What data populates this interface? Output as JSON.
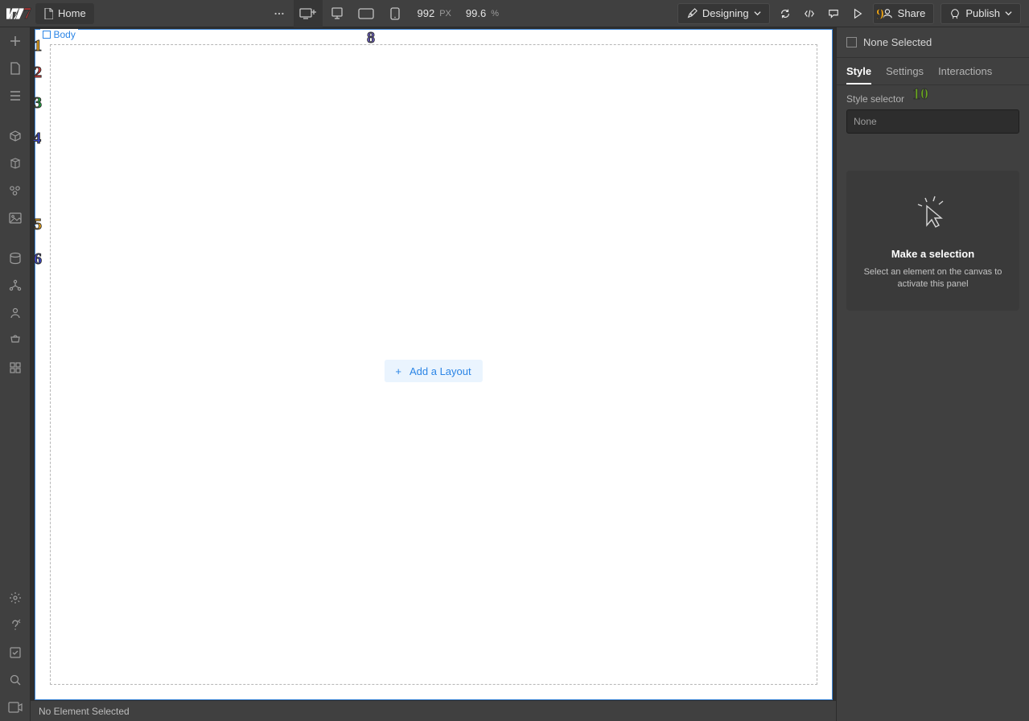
{
  "topbar": {
    "page_name": "Home",
    "mode_label": "Designing",
    "share_label": "Share",
    "publish_label": "Publish",
    "viewport_width": "992",
    "viewport_unit": "PX",
    "zoom_value": "99.6",
    "zoom_unit": "%"
  },
  "canvas": {
    "body_label": "Body",
    "add_layout_label": "Add a Layout"
  },
  "statusbar": {
    "message": "No Element Selected"
  },
  "rightpanel": {
    "header_label": "None Selected",
    "tabs": {
      "style": "Style",
      "settings": "Settings",
      "interactions": "Interactions"
    },
    "selector_label": "Style selector",
    "selector_placeholder": "None",
    "empty_title": "Make a selection",
    "empty_desc": "Select an element on the canvas to activate this panel"
  },
  "markers": {
    "m1": "1",
    "m2": "2",
    "m3": "3",
    "m4": "4",
    "m5": "5",
    "m6": "6",
    "m7": "7",
    "m8": "8",
    "m9": "9",
    "m10": "10"
  }
}
